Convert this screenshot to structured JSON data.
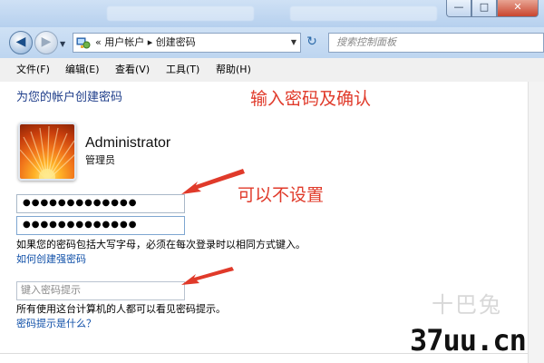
{
  "window": {
    "background_tabs": [
      "",
      ""
    ],
    "controls": {
      "minimize": "—",
      "maximize": "□",
      "close": "✕"
    }
  },
  "nav": {
    "back_glyph": "◀",
    "forward_glyph": "▶",
    "address": {
      "icon": "control-panel-icon",
      "text": "« 用户帐户 ▸ 创建密码"
    },
    "refresh_glyph": "↻",
    "search_placeholder": "搜索控制面板"
  },
  "menu": {
    "items": [
      "文件(F)",
      "编辑(E)",
      "查看(V)",
      "工具(T)",
      "帮助(H)"
    ]
  },
  "page": {
    "title": "为您的帐户创建密码",
    "user": {
      "name": "Administrator",
      "role": "管理员"
    },
    "password": "●●●●●●●●●●●●●",
    "confirm_password": "●●●●●●●●●●●●●",
    "caps_note": "如果您的密码包括大写字母，必须在每次登录时以相同方式键入。",
    "strong_link": "如何创建强密码",
    "hint_placeholder": "键入密码提示",
    "hint_note": "所有使用这台计算机的人都可以看见密码提示。",
    "hint_link": "密码提示是什么？"
  },
  "annotations": {
    "text1": "输入密码及确认",
    "text2": "可以不设置",
    "color": "#e03a2a"
  },
  "watermark": {
    "faint": "十巴兔",
    "brand": "37uu.cn"
  },
  "colors": {
    "title_blue": "#1e3d8a",
    "link_blue": "#0f4fa8"
  }
}
